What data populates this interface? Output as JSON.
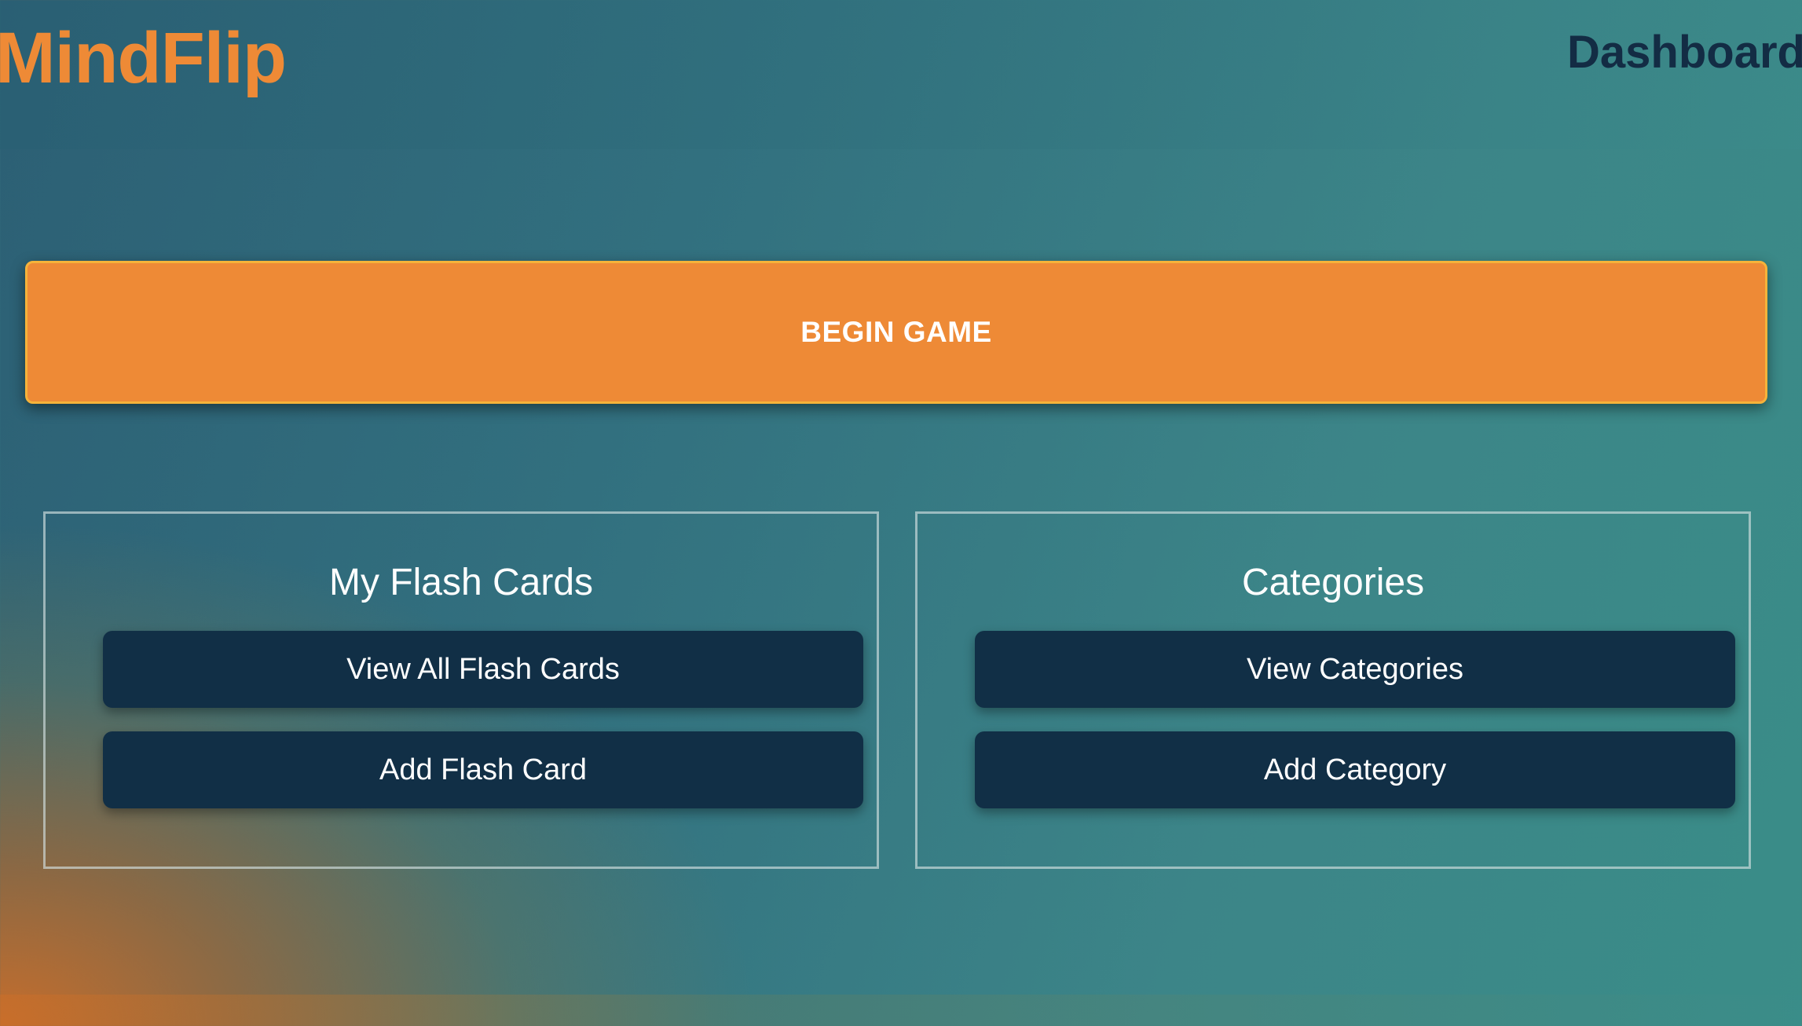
{
  "header": {
    "logo": "MindFlip",
    "page_title": "Dashboard"
  },
  "main": {
    "begin_game_label": "BEGIN GAME",
    "panels": [
      {
        "title": "My Flash Cards",
        "buttons": [
          "View All Flash Cards",
          "Add Flash Card"
        ]
      },
      {
        "title": "Categories",
        "buttons": [
          "View Categories",
          "Add Category"
        ]
      }
    ]
  },
  "colors": {
    "accent": "#ee8a36",
    "button_dark": "#112f46",
    "title_dark": "#132c44"
  }
}
